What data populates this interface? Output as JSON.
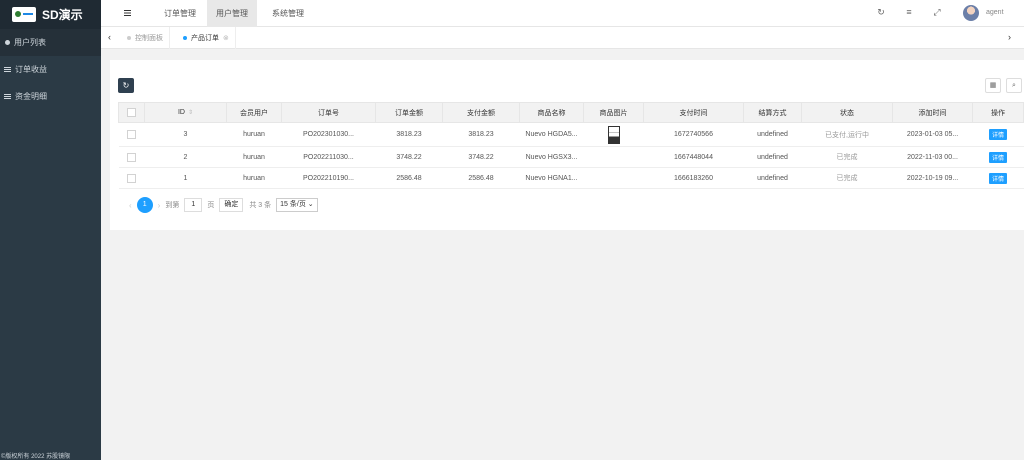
{
  "brand": {
    "name": "SD演示"
  },
  "sidebar": {
    "items": [
      {
        "label": "用户列表",
        "icon": "users-icon"
      },
      {
        "label": "订单收益",
        "icon": "list-icon"
      },
      {
        "label": "资金明细",
        "icon": "list-icon"
      }
    ],
    "footer": "©版权所有 2022 苏股镜限"
  },
  "header": {
    "nav": [
      "订单管理",
      "用户管理",
      "系统管理"
    ],
    "active_nav": 1,
    "username": "agent"
  },
  "tabs": [
    {
      "label": "控制面板"
    },
    {
      "label": "产品订单",
      "close": "⊗"
    }
  ],
  "table": {
    "columns": [
      "ID",
      "会员用户",
      "订单号",
      "订单金额",
      "支付金额",
      "商品名称",
      "商品图片",
      "支付时间",
      "结算方式",
      "状态",
      "添加时间",
      "操作"
    ],
    "rows": [
      {
        "id": "3",
        "user": "huruan",
        "order_no": "PO202301030...",
        "amount": "3818.23",
        "paid": "3818.23",
        "product": "Nuevo HGDA5...",
        "pay_time": "1672740566",
        "settle": "undefined",
        "status": "已支付,运行中",
        "added": "2023-01-03 05...",
        "action": "详情"
      },
      {
        "id": "2",
        "user": "huruan",
        "order_no": "PO202211030...",
        "amount": "3748.22",
        "paid": "3748.22",
        "product": "Nuevo HGSX3...",
        "pay_time": "1667448044",
        "settle": "undefined",
        "status": "已完成",
        "added": "2022-11-03 00...",
        "action": "详情"
      },
      {
        "id": "1",
        "user": "huruan",
        "order_no": "PO202210190...",
        "amount": "2586.48",
        "paid": "2586.48",
        "product": "Nuevo HGNA1...",
        "pay_time": "1666183260",
        "settle": "undefined",
        "status": "已完成",
        "added": "2022-10-19 09...",
        "action": "详情"
      }
    ]
  },
  "pagination": {
    "current": "1",
    "goto_label": "到第",
    "goto_value": "1",
    "page_unit": "页",
    "confirm": "确定",
    "total": "共 3 条",
    "page_size": "15 条/页"
  },
  "colors": {
    "accent": "#1e9fff",
    "sidebar": "#2b3a45"
  }
}
